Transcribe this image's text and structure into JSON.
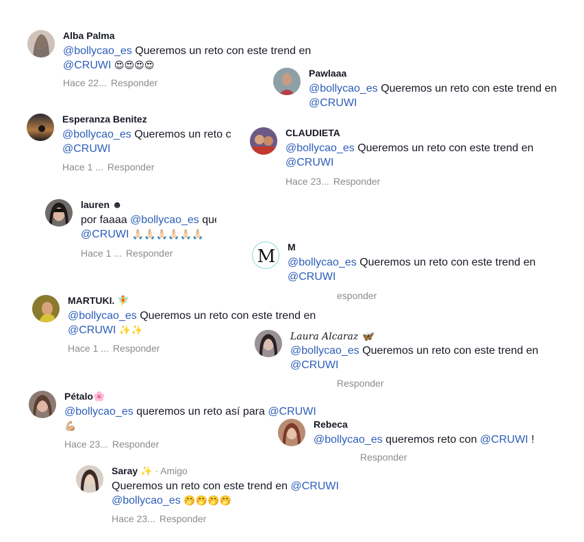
{
  "comments": {
    "alba": {
      "name": "Alba Palma",
      "mention": "@bollycao_es",
      "text": " Queremos un reto con este trend en",
      "mention2": "@CRUWI",
      "emoji": "😍😍😍😍",
      "time": "Hace 22...",
      "reply": "Responder"
    },
    "pawlaaa": {
      "name": "Pawlaaa",
      "mention": "@bollycao_es",
      "text": " Queremos un reto con este trend en",
      "mention2": "@CRUWI"
    },
    "esperanza": {
      "name": "Esperanza Benitez",
      "mention": "@bollycao_es",
      "text": " Queremos un reto c",
      "mention2": "@CRUWI",
      "time": "Hace 1 ...",
      "reply": "Responder"
    },
    "claudieta": {
      "name": "CLAUDIETA",
      "mention": "@bollycao_es",
      "text": " Queremos un reto con este trend en",
      "mention2": "@CRUWI",
      "time": "Hace 23...",
      "reply": "Responder"
    },
    "lauren": {
      "name": "lauren ☻",
      "prefix": "por faaaa ",
      "mention": "@bollycao_es",
      "text": " queremos un reto así con",
      "mention2": "@CRUWI",
      "emoji": "🙏🏻🙏🏻🙏🏻🙏🏻🙏🏻🙏🏻",
      "time": "Hace 1 ...",
      "reply": "Responder"
    },
    "m": {
      "name": "M",
      "mention": "@bollycao_es",
      "text": " Queremos un reto con este trend en",
      "mention2": "@CRUWI",
      "reply": "esponder"
    },
    "martuki": {
      "name": "MARTUKI. 🧚",
      "mention": "@bollycao_es",
      "text": " Queremos un reto con este trend en",
      "mention2": "@CRUWI",
      "emoji": "✨✨",
      "time": "Hace 1 ...",
      "reply": "Responder"
    },
    "laura": {
      "name": "Laura Alcaraz 🦋",
      "mention": "@bollycao_es",
      "text": " Queremos un reto con este trend en",
      "mention2": "@CRUWI",
      "reply": "Responder"
    },
    "petalo": {
      "name": "Pétalo🌸",
      "mention": "@bollycao_es",
      "text": " queremos un reto así para ",
      "mention2": "@CRUWI",
      "emoji": "💪🏼",
      "time": "Hace 23...",
      "reply": "Responder"
    },
    "rebeca": {
      "name": "Rebeca",
      "mention": "@bollycao_es",
      "text": " queremos reto con ",
      "mention2": "@CRUWI",
      "suffix": " !",
      "reply": "Responder"
    },
    "saray": {
      "name": "Saray ✨",
      "extra": " · Amigo",
      "prefix": "Queremos un reto con este trend en ",
      "mention": "@CRUWI",
      "mention2": "@bollycao_es",
      "emoji": " 🤭🤭🤭🤭",
      "time": "Hace 23...",
      "reply": "Responder"
    }
  }
}
